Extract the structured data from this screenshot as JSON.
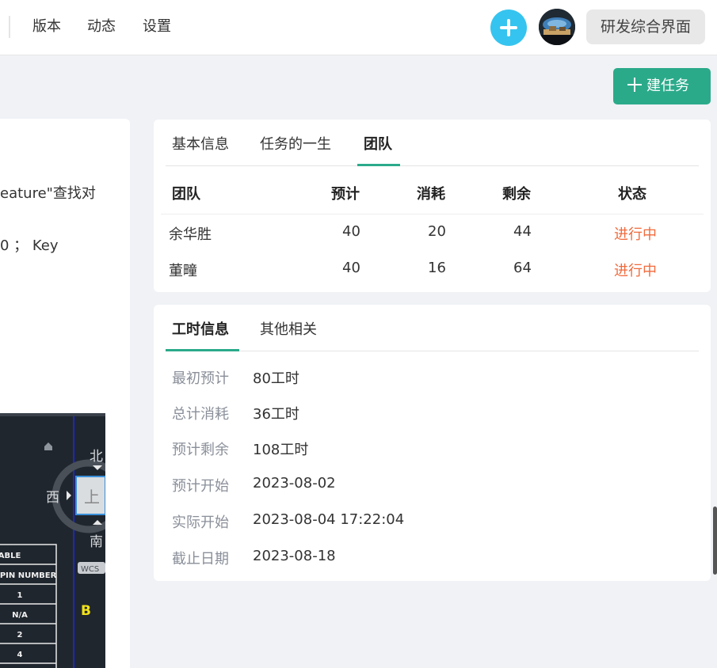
{
  "nav": {
    "items": [
      "版本",
      "动态",
      "设置"
    ],
    "project_name": "研发综合界面"
  },
  "toolbar": {
    "create_task_label": "建任务"
  },
  "left": {
    "text_line_1": "eature\"查找对",
    "text_line_2": "0 ； Key",
    "cad": {
      "compass_north": "北",
      "compass_south": "南",
      "compass_west": "西",
      "compass_center": "上",
      "wcs": "WCS",
      "marker": "B",
      "table_rows": [
        "ABLE",
        "R PIN NUMBER",
        "1",
        "N/A",
        "2",
        "4"
      ]
    }
  },
  "team_card": {
    "tabs": [
      "基本信息",
      "任务的一生",
      "团队"
    ],
    "active_tab": 2,
    "headers": [
      "团队",
      "预计",
      "消耗",
      "剩余",
      "状态"
    ],
    "rows": [
      {
        "name": "余华胜",
        "estimate": "40",
        "consumed": "20",
        "remaining": "44",
        "status": "进行中"
      },
      {
        "name": "董疃",
        "estimate": "40",
        "consumed": "16",
        "remaining": "64",
        "status": "进行中"
      }
    ]
  },
  "hours_card": {
    "tabs": [
      "工时信息",
      "其他相关"
    ],
    "active_tab": 0,
    "items": [
      {
        "label": "最初预计",
        "value": "80工时"
      },
      {
        "label": "总计消耗",
        "value": "36工时"
      },
      {
        "label": "预计剩余",
        "value": "108工时"
      },
      {
        "label": "预计开始",
        "value": "2023-08-02"
      },
      {
        "label": "实际开始",
        "value": "2023-08-04 17:22:04"
      },
      {
        "label": "截止日期",
        "value": "2023-08-18"
      }
    ]
  },
  "colors": {
    "accent": "#2baa8a",
    "status": "#f06a3c",
    "add_circle": "#35c4ef"
  }
}
